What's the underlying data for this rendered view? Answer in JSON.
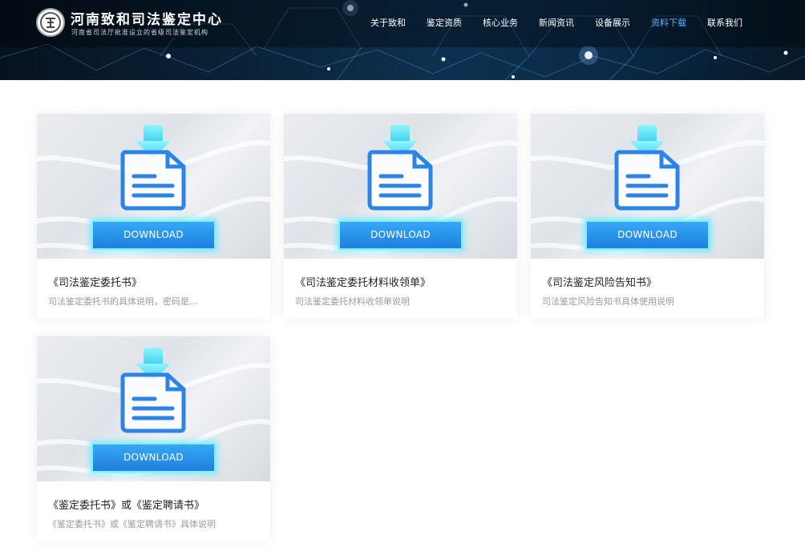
{
  "header": {
    "brand_name": "河南致和司法鉴定中心",
    "brand_subtitle": "河南省司法厅批准设立的省级司法鉴定机构",
    "nav": [
      {
        "label": "关于致和"
      },
      {
        "label": "鉴定资质"
      },
      {
        "label": "核心业务"
      },
      {
        "label": "新闻资讯"
      },
      {
        "label": "设备展示"
      },
      {
        "label": "资料下载",
        "active": true
      },
      {
        "label": "联系我们"
      }
    ],
    "active_nav_color": "#4cb8ff"
  },
  "downloads": [
    {
      "button_label": "DOWNLOAD",
      "title": "《司法鉴定委托书》",
      "description": "司法鉴定委托书的具体说明，密码是..."
    },
    {
      "button_label": "DOWNLOAD",
      "title": "《司法鉴定委托材料收领单》",
      "description": "司法鉴定委托材料收领单说明"
    },
    {
      "button_label": "DOWNLOAD",
      "title": "《司法鉴定风险告知书》",
      "description": "司法鉴定风险告知书具体使用说明"
    },
    {
      "button_label": "DOWNLOAD",
      "title": "《鉴定委托书》或《鉴定聘请书》",
      "description": "《鉴定委托书》或《鉴定聘请书》具体说明"
    }
  ],
  "icons": {
    "logo": "seal-logo-icon",
    "document": "document-download-icon"
  },
  "colors": {
    "download_button": "#2a8fe8",
    "download_glow": "#7ff0ff"
  }
}
